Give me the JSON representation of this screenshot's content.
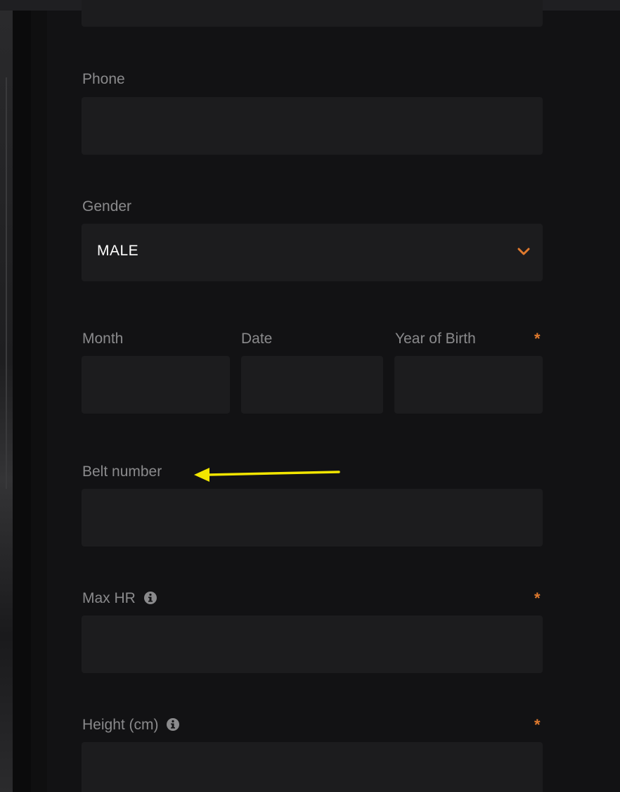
{
  "form": {
    "phone": {
      "label": "Phone",
      "value": ""
    },
    "gender": {
      "label": "Gender",
      "value": "MALE"
    },
    "birth": {
      "month_label": "Month",
      "date_label": "Date",
      "year_label": "Year of Birth",
      "required_mark": "*"
    },
    "belt": {
      "label": "Belt number"
    },
    "max_hr": {
      "label": "Max HR",
      "required_mark": "*",
      "icon": "info-icon"
    },
    "height": {
      "label": "Height (cm)",
      "required_mark": "*",
      "icon": "info-icon"
    }
  },
  "colors": {
    "accent": "#e07a2e",
    "annotation_arrow": "#f2e600",
    "field_bg": "#1c1c1e",
    "label": "#8a8a8c"
  }
}
